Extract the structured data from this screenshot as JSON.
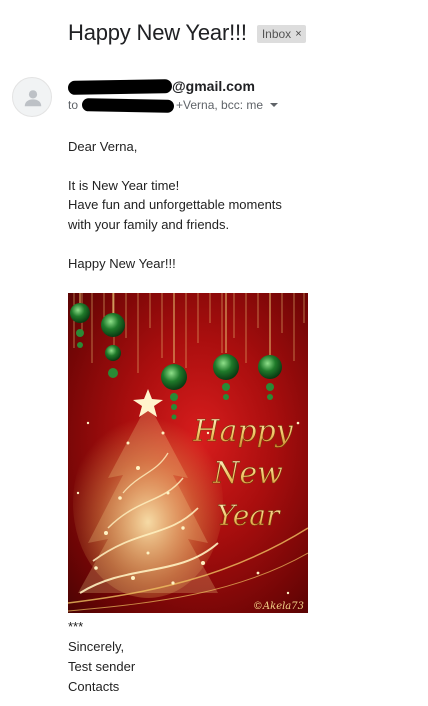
{
  "email": {
    "subject": "Happy New Year!!!",
    "label": "Inbox",
    "sender_visible": "@gmail.com",
    "recipients_prefix": "to",
    "recipients_visible": "+Verna, bcc: me"
  },
  "body": {
    "greeting": "Dear Verna,",
    "line1": "It is New Year time!",
    "line2": "Have fun and unforgettable moments",
    "line3": "with your family and friends.",
    "wish": "Happy New Year!!!",
    "stars": "***",
    "closing": "Sincerely,",
    "signature": "Test sender",
    "contacts": "Contacts"
  },
  "card": {
    "word1": "Happy",
    "word2": "New",
    "word3": "Year",
    "credit": "©Akela73"
  },
  "icons": {
    "label_remove": "close-icon",
    "avatar": "person-icon",
    "details": "caret-down-icon"
  },
  "colors": {
    "card_red": "#b01010",
    "gold": "#f3d48a",
    "ornament_green": "#1f7a2a"
  }
}
